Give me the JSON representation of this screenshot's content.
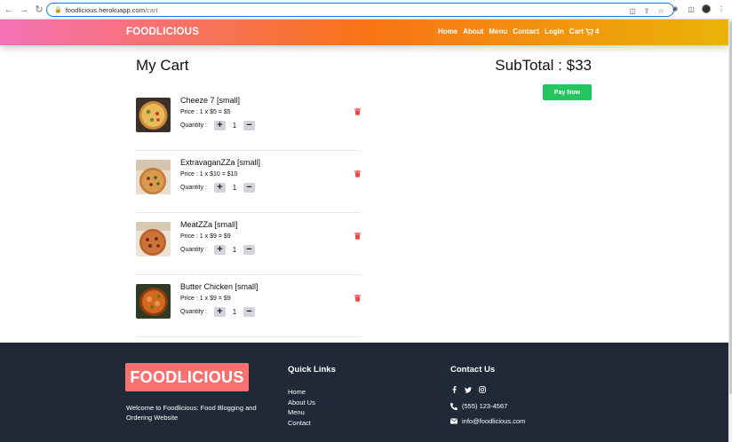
{
  "browser": {
    "url_domain": "foodlicious.herokuapp.com",
    "url_path": "/cart"
  },
  "navbar": {
    "brand": "FOODLICIOUS",
    "links": [
      "Home",
      "About",
      "Menu",
      "Contact",
      "Login"
    ],
    "cart_label": "Cart",
    "cart_count": "4",
    "gradient_colors": [
      "#f472b6",
      "#f97316",
      "#eab308"
    ]
  },
  "cart": {
    "title": "My Cart",
    "subtotal": "SubTotal : $33",
    "pay_label": "Pay Now",
    "quantity_label": "Quantity :",
    "items": [
      {
        "name": "Cheeze 7 [small]",
        "price": "Price : 1 x $5 = $5",
        "qty": "1",
        "image": "pizza-cheese"
      },
      {
        "name": "ExtravaganZZa [small]",
        "price": "Price : 1 x $10 = $10",
        "qty": "1",
        "image": "pizza-box"
      },
      {
        "name": "MeatZZa [small]",
        "price": "Price : 1 x $9 = $9",
        "qty": "1",
        "image": "pizza-box"
      },
      {
        "name": "Butter Chicken [small]",
        "price": "Price : 1 x $9 = $9",
        "qty": "1",
        "image": "curry-bowl"
      }
    ]
  },
  "footer": {
    "logo": "FOODLICIOUS",
    "tagline": "Welcome to Foodlicious: Food Blogging and Ordering Website",
    "quick_links_title": "Quick Links",
    "quick_links": [
      "Home",
      "About Us",
      "Menu",
      "Contact"
    ],
    "contact_title": "Contact Us",
    "phone": "(555) 123-4567",
    "email": "info@foodlicious.com",
    "social_icons": [
      "facebook-icon",
      "twitter-icon",
      "instagram-icon"
    ]
  },
  "colors": {
    "pay_button": "#22c55e",
    "footer_bg": "#1f2937",
    "footer_logo_bg": "#f87171",
    "delete_icon": "#ef4444"
  }
}
